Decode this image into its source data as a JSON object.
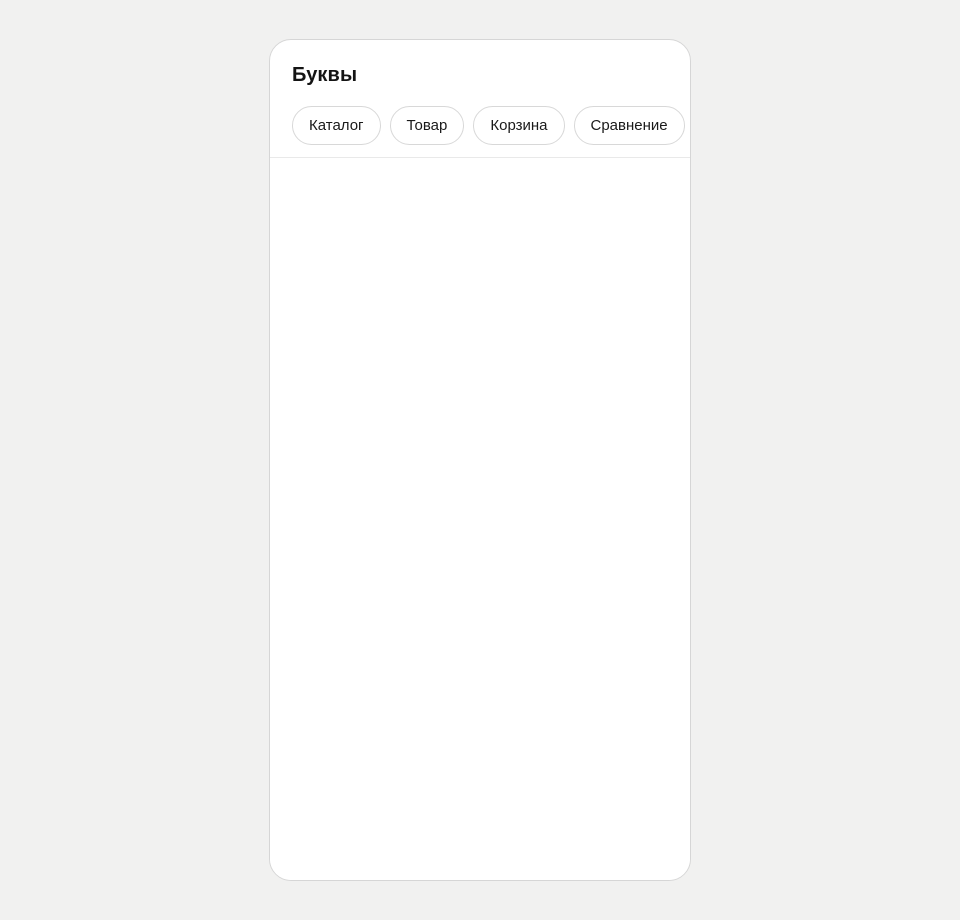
{
  "app": {
    "title": "Буквы"
  },
  "tabs": [
    {
      "label": "Каталог"
    },
    {
      "label": "Товар"
    },
    {
      "label": "Корзина"
    },
    {
      "label": "Сравнение"
    }
  ],
  "colors": {
    "page_background": "#f1f1f0",
    "frame_background": "#ffffff",
    "frame_border": "#d6d6d6",
    "text": "#141414",
    "tab_border": "#d8d8d8"
  }
}
